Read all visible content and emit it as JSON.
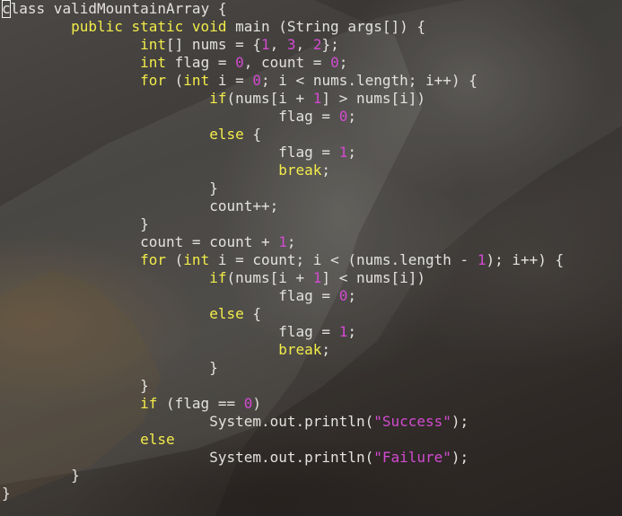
{
  "editor": {
    "colors": {
      "keyword": "#f3ec4a",
      "literal": "#d24ad0",
      "text": "#e2e2de"
    },
    "code_lines": [
      [
        {
          "t": "c",
          "k": "cursor"
        },
        {
          "t": "lass validMountainArray {",
          "k": "op"
        }
      ],
      [
        {
          "t": "        ",
          "k": "op"
        },
        {
          "t": "public static void",
          "k": "kw"
        },
        {
          "t": " main (String args[]) {",
          "k": "op"
        }
      ],
      [
        {
          "t": "                ",
          "k": "op"
        },
        {
          "t": "int",
          "k": "kw"
        },
        {
          "t": "[] nums = {",
          "k": "op"
        },
        {
          "t": "1",
          "k": "num"
        },
        {
          "t": ", ",
          "k": "op"
        },
        {
          "t": "3",
          "k": "num"
        },
        {
          "t": ", ",
          "k": "op"
        },
        {
          "t": "2",
          "k": "num"
        },
        {
          "t": "};",
          "k": "op"
        }
      ],
      [
        {
          "t": "                ",
          "k": "op"
        },
        {
          "t": "int",
          "k": "kw"
        },
        {
          "t": " flag = ",
          "k": "op"
        },
        {
          "t": "0",
          "k": "num"
        },
        {
          "t": ", count = ",
          "k": "op"
        },
        {
          "t": "0",
          "k": "num"
        },
        {
          "t": ";",
          "k": "op"
        }
      ],
      [
        {
          "t": "                ",
          "k": "op"
        },
        {
          "t": "for",
          "k": "kw"
        },
        {
          "t": " (",
          "k": "op"
        },
        {
          "t": "int",
          "k": "kw"
        },
        {
          "t": " i = ",
          "k": "op"
        },
        {
          "t": "0",
          "k": "num"
        },
        {
          "t": "; i < nums.length; i++) {",
          "k": "op"
        }
      ],
      [
        {
          "t": "                        ",
          "k": "op"
        },
        {
          "t": "if",
          "k": "kw"
        },
        {
          "t": "(nums[i + ",
          "k": "op"
        },
        {
          "t": "1",
          "k": "num"
        },
        {
          "t": "] > nums[i])",
          "k": "op"
        }
      ],
      [
        {
          "t": "                                flag = ",
          "k": "op"
        },
        {
          "t": "0",
          "k": "num"
        },
        {
          "t": ";",
          "k": "op"
        }
      ],
      [
        {
          "t": "                        ",
          "k": "op"
        },
        {
          "t": "else",
          "k": "kw"
        },
        {
          "t": " {",
          "k": "op"
        }
      ],
      [
        {
          "t": "                                flag = ",
          "k": "op"
        },
        {
          "t": "1",
          "k": "num"
        },
        {
          "t": ";",
          "k": "op"
        }
      ],
      [
        {
          "t": "                                ",
          "k": "op"
        },
        {
          "t": "break",
          "k": "kw"
        },
        {
          "t": ";",
          "k": "op"
        }
      ],
      [
        {
          "t": "                        }",
          "k": "op"
        }
      ],
      [
        {
          "t": "                        count++;",
          "k": "op"
        }
      ],
      [
        {
          "t": "                }",
          "k": "op"
        }
      ],
      [
        {
          "t": "                count = count + ",
          "k": "op"
        },
        {
          "t": "1",
          "k": "num"
        },
        {
          "t": ";",
          "k": "op"
        }
      ],
      [
        {
          "t": "                ",
          "k": "op"
        },
        {
          "t": "for",
          "k": "kw"
        },
        {
          "t": " (",
          "k": "op"
        },
        {
          "t": "int",
          "k": "kw"
        },
        {
          "t": " i = count; i < (nums.length - ",
          "k": "op"
        },
        {
          "t": "1",
          "k": "num"
        },
        {
          "t": "); i++) {",
          "k": "op"
        }
      ],
      [
        {
          "t": "                        ",
          "k": "op"
        },
        {
          "t": "if",
          "k": "kw"
        },
        {
          "t": "(nums[i + ",
          "k": "op"
        },
        {
          "t": "1",
          "k": "num"
        },
        {
          "t": "] < nums[i])",
          "k": "op"
        }
      ],
      [
        {
          "t": "                                flag = ",
          "k": "op"
        },
        {
          "t": "0",
          "k": "num"
        },
        {
          "t": ";",
          "k": "op"
        }
      ],
      [
        {
          "t": "                        ",
          "k": "op"
        },
        {
          "t": "else",
          "k": "kw"
        },
        {
          "t": " {",
          "k": "op"
        }
      ],
      [
        {
          "t": "                                flag = ",
          "k": "op"
        },
        {
          "t": "1",
          "k": "num"
        },
        {
          "t": ";",
          "k": "op"
        }
      ],
      [
        {
          "t": "                                ",
          "k": "op"
        },
        {
          "t": "break",
          "k": "kw"
        },
        {
          "t": ";",
          "k": "op"
        }
      ],
      [
        {
          "t": "                        }",
          "k": "op"
        }
      ],
      [
        {
          "t": "                }",
          "k": "op"
        }
      ],
      [
        {
          "t": "                ",
          "k": "op"
        },
        {
          "t": "if",
          "k": "kw"
        },
        {
          "t": " (flag == ",
          "k": "op"
        },
        {
          "t": "0",
          "k": "num"
        },
        {
          "t": ")",
          "k": "op"
        }
      ],
      [
        {
          "t": "                        System.out.println(",
          "k": "op"
        },
        {
          "t": "\"Success\"",
          "k": "str"
        },
        {
          "t": ");",
          "k": "op"
        }
      ],
      [
        {
          "t": "                ",
          "k": "op"
        },
        {
          "t": "else",
          "k": "kw"
        }
      ],
      [
        {
          "t": "                        System.out.println(",
          "k": "op"
        },
        {
          "t": "\"Failure\"",
          "k": "str"
        },
        {
          "t": ");",
          "k": "op"
        }
      ],
      [
        {
          "t": "        }",
          "k": "op"
        }
      ],
      [
        {
          "t": "}",
          "k": "op"
        }
      ]
    ]
  }
}
